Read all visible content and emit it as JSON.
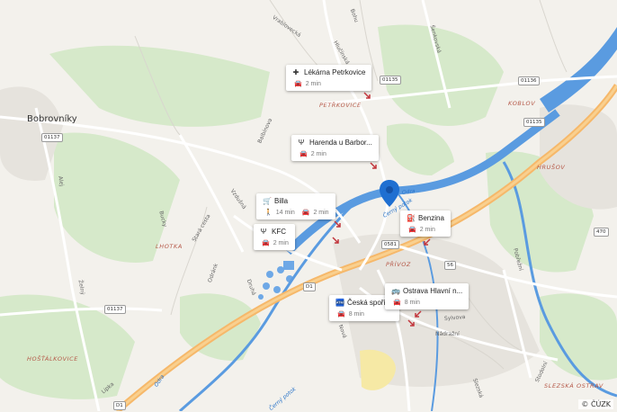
{
  "map": {
    "place_labels": {
      "bobrovniky": "Bobrovníky",
      "petrkovice": "PETŘKOVICE",
      "koblov": "KOBLOV",
      "hrusov": "HRUŠOV",
      "lhotka": "LHOTKA",
      "privoz": "PŘÍVOZ",
      "hostalkovice": "HOŠŤÁLKOVICE",
      "slezska": "SLEZSKÁ OSTRAV"
    },
    "street_labels": {
      "vrablovecka": "Vrablovecká",
      "hlucinska": "Hlučínská",
      "bohumin": "Bohu",
      "serikovska": "Šenkovská",
      "balbinova": "Balbínova",
      "vzdusna": "Vzdušná",
      "bucky": "Bucky",
      "stara_cesta": "Stará cesta",
      "alej": "Alej",
      "zelny": "Želný",
      "druha": "Druhá",
      "odrank": "Odránk",
      "nadrazni": "Nádražní",
      "sylvova": "Sylvova",
      "pobrezni": "Pobřežní",
      "nova": "Nová",
      "lipka": "Lipka",
      "slezska_ul": "Slezská",
      "stodolni": "Stodolní"
    },
    "water_labels": {
      "odra": "Odra",
      "cerny_potok": "Černý potok",
      "cerny_potok_2": "Černý potok",
      "odra_2": "Odra"
    },
    "road_numbers": {
      "r1137": "01137",
      "r1135a": "01135",
      "r1136": "01136",
      "r1135b": "01135",
      "r0581": "0581",
      "r56": "56",
      "r470": "470",
      "rD1a": "D1",
      "rD1b": "D1",
      "r01137b": "01137"
    }
  },
  "pois": [
    {
      "name": "Lékárna Petrkovice",
      "icon": "pharmacy-icon",
      "glyph": "✚",
      "mode_icon": "car-icon",
      "time": "2 min"
    },
    {
      "name": "Harenda u Barbor...",
      "icon": "restaurant-icon",
      "glyph": "🍴",
      "mode_icon": "car-icon",
      "time": "2 min"
    },
    {
      "name": "Billa",
      "icon": "cart-icon",
      "glyph": "🛒",
      "walk_icon": "walk-icon",
      "walk_time": "14 min",
      "mode_icon": "car-icon",
      "time": "2 min"
    },
    {
      "name": "KFC",
      "icon": "restaurant-icon",
      "glyph": "🍴",
      "mode_icon": "car-icon",
      "time": "2 min"
    },
    {
      "name": "Benzina",
      "icon": "gas-station-icon",
      "glyph": "⛽",
      "mode_icon": "car-icon",
      "time": "2 min"
    },
    {
      "name": "Česká spořit...",
      "icon": "atm-icon",
      "glyph": "🏧",
      "mode_icon": "car-icon",
      "time": "8 min"
    },
    {
      "name": "Ostrava Hlavní n...",
      "icon": "bus-icon",
      "glyph": "🚌",
      "mode_icon": "car-icon",
      "time": "8 min"
    }
  ],
  "copyright": "© ČÚZK",
  "colors": {
    "river": "#5a9be0",
    "river_outline": "#3f86d3",
    "forest": "#d3e8c7",
    "motorway": "#f6b86a",
    "road": "#ffffff",
    "pin": "#1f6fd1",
    "background": "#f3f1ec"
  }
}
